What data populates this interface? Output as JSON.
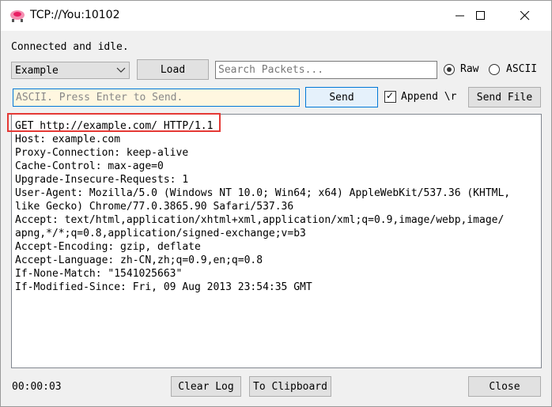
{
  "window": {
    "title": "TCP://You:10102"
  },
  "status": "Connected and idle.",
  "toolbar1": {
    "preset_value": "Example",
    "load_label": "Load",
    "search_placeholder": "Search Packets...",
    "raw_label": "Raw",
    "ascii_label": "ASCII",
    "raw_selected": true
  },
  "toolbar2": {
    "send_placeholder": "ASCII. Press Enter to Send.",
    "send_label": "Send",
    "append_label": "Append \\r",
    "append_checked": true,
    "send_file_label": "Send File"
  },
  "log": {
    "lines": [
      "GET http://example.com/ HTTP/1.1",
      "Host: example.com",
      "Proxy-Connection: keep-alive",
      "Cache-Control: max-age=0",
      "Upgrade-Insecure-Requests: 1",
      "User-Agent: Mozilla/5.0 (Windows NT 10.0; Win64; x64) AppleWebKit/537.36 (KHTML,",
      "like Gecko) Chrome/77.0.3865.90 Safari/537.36",
      "Accept: text/html,application/xhtml+xml,application/xml;q=0.9,image/webp,image/",
      "apng,*/*;q=0.8,application/signed-exchange;v=b3",
      "Accept-Encoding: gzip, deflate",
      "Accept-Language: zh-CN,zh;q=0.9,en;q=0.8",
      "If-None-Match: \"1541025663\"",
      "If-Modified-Since: Fri, 09 Aug 2013 23:54:35 GMT"
    ]
  },
  "footer": {
    "timer": "00:00:03",
    "clear_log_label": "Clear Log",
    "clipboard_label": "To Clipboard",
    "close_label": "Close"
  },
  "colors": {
    "highlight": "#e53935",
    "focus": "#0078d7",
    "input_active_bg": "#fff7e0"
  },
  "icons": [
    "app-icon",
    "minimize-icon",
    "maximize-icon",
    "close-icon",
    "chevron-down-icon",
    "check-icon"
  ]
}
